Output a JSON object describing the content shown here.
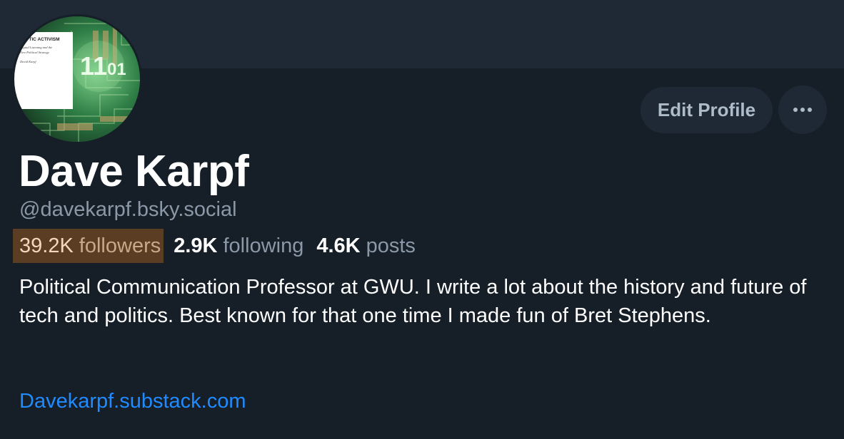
{
  "profile": {
    "display_name": "Dave Karpf",
    "handle": "@davekarpf.bsky.social",
    "bio": "Political Communication Professor at GWU. I write a lot about the history and future of tech and politics. Best known for that one time I made fun of Bret Stephens.",
    "link_text": "Davekarpf.substack.com"
  },
  "stats": {
    "followers_count": "39.2K",
    "followers_label": "followers",
    "following_count": "2.9K",
    "following_label": "following",
    "posts_count": "4.6K",
    "posts_label": "posts"
  },
  "actions": {
    "edit_profile_label": "Edit Profile",
    "more_icon": "more-horizontal-icon"
  },
  "avatar": {
    "book_title": "ALYTIC ACTIVISM",
    "book_subtitle_line1": "Digital Listening and the",
    "book_subtitle_line2": "New Political Strategy",
    "book_author": "David Karpf",
    "digits_1": "11",
    "digits_2": "01"
  },
  "colors": {
    "background": "#161e27",
    "banner": "#1e2935",
    "text_primary": "#ffffff",
    "text_secondary": "#8a98a8",
    "link": "#208bfe",
    "followers_highlight": "#5b3d23"
  }
}
